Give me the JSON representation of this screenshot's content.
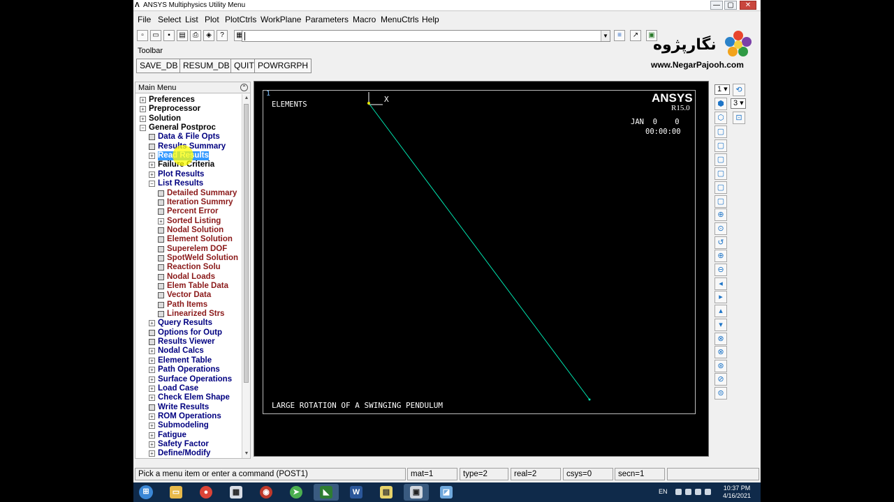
{
  "window": {
    "title": "ANSYS Multiphysics Utility Menu",
    "controls": {
      "minimize": "—",
      "maximize": "▢",
      "close": "✕"
    }
  },
  "menubar": [
    "File",
    "Select",
    "List",
    "Plot",
    "PlotCtrls",
    "WorkPlane",
    "Parameters",
    "Macro",
    "MenuCtrls",
    "Help"
  ],
  "command_input": {
    "value": ""
  },
  "toolbar": {
    "label": "Toolbar",
    "buttons": [
      "SAVE_DB",
      "RESUM_DB",
      "QUIT",
      "POWRGRPH"
    ]
  },
  "brand": {
    "name_fa": "نگارپژوه",
    "url": "www.NegarPajooh.com"
  },
  "main_menu": {
    "header": "Main Menu",
    "items": [
      {
        "label": "Preferences",
        "level": 0,
        "box": "+",
        "color": "black"
      },
      {
        "label": "Preprocessor",
        "level": 0,
        "box": "+",
        "color": "black"
      },
      {
        "label": "Solution",
        "level": 0,
        "box": "+",
        "color": "black"
      },
      {
        "label": "General Postproc",
        "level": 0,
        "box": "−",
        "color": "black"
      },
      {
        "label": "Data & File Opts",
        "level": 1,
        "box": "leaf",
        "color": "navy"
      },
      {
        "label": "Results Summary",
        "level": 1,
        "box": "leaf",
        "color": "navy"
      },
      {
        "label": "Read Results",
        "level": 1,
        "box": "+",
        "color": "navy",
        "selected": true
      },
      {
        "label": "Failure Criteria",
        "level": 1,
        "box": "+",
        "color": "black"
      },
      {
        "label": "Plot Results",
        "level": 1,
        "box": "+",
        "color": "navy"
      },
      {
        "label": "List Results",
        "level": 1,
        "box": "−",
        "color": "navy"
      },
      {
        "label": "Detailed Summary",
        "level": 2,
        "box": "leaf",
        "color": "brown"
      },
      {
        "label": "Iteration Summry",
        "level": 2,
        "box": "leaf",
        "color": "brown"
      },
      {
        "label": "Percent Error",
        "level": 2,
        "box": "leaf",
        "color": "brown"
      },
      {
        "label": "Sorted Listing",
        "level": 2,
        "box": "+",
        "color": "brown"
      },
      {
        "label": "Nodal Solution",
        "level": 2,
        "box": "leaf",
        "color": "brown"
      },
      {
        "label": "Element Solution",
        "level": 2,
        "box": "leaf",
        "color": "brown"
      },
      {
        "label": "Superelem DOF",
        "level": 2,
        "box": "leaf",
        "color": "brown"
      },
      {
        "label": "SpotWeld Solution",
        "level": 2,
        "box": "leaf",
        "color": "brown"
      },
      {
        "label": "Reaction Solu",
        "level": 2,
        "box": "leaf",
        "color": "brown"
      },
      {
        "label": "Nodal Loads",
        "level": 2,
        "box": "leaf",
        "color": "brown"
      },
      {
        "label": "Elem Table Data",
        "level": 2,
        "box": "leaf",
        "color": "brown"
      },
      {
        "label": "Vector Data",
        "level": 2,
        "box": "leaf",
        "color": "brown"
      },
      {
        "label": "Path Items",
        "level": 2,
        "box": "leaf",
        "color": "brown"
      },
      {
        "label": "Linearized Strs",
        "level": 2,
        "box": "leaf",
        "color": "brown"
      },
      {
        "label": "Query Results",
        "level": 1,
        "box": "+",
        "color": "navy"
      },
      {
        "label": "Options for Outp",
        "level": 1,
        "box": "leaf",
        "color": "navy"
      },
      {
        "label": "Results Viewer",
        "level": 1,
        "box": "leaf",
        "color": "navy"
      },
      {
        "label": "Nodal Calcs",
        "level": 1,
        "box": "+",
        "color": "navy"
      },
      {
        "label": "Element Table",
        "level": 1,
        "box": "+",
        "color": "navy"
      },
      {
        "label": "Path Operations",
        "level": 1,
        "box": "+",
        "color": "navy"
      },
      {
        "label": "Surface Operations",
        "level": 1,
        "box": "+",
        "color": "navy"
      },
      {
        "label": "Load Case",
        "level": 1,
        "box": "+",
        "color": "navy"
      },
      {
        "label": "Check Elem Shape",
        "level": 1,
        "box": "+",
        "color": "navy"
      },
      {
        "label": "Write Results",
        "level": 1,
        "box": "leaf",
        "color": "navy"
      },
      {
        "label": "ROM Operations",
        "level": 1,
        "box": "+",
        "color": "navy"
      },
      {
        "label": "Submodeling",
        "level": 1,
        "box": "+",
        "color": "navy"
      },
      {
        "label": "Fatigue",
        "level": 1,
        "box": "+",
        "color": "navy"
      },
      {
        "label": "Safety Factor",
        "level": 1,
        "box": "+",
        "color": "navy"
      },
      {
        "label": "Define/Modify",
        "level": 1,
        "box": "+",
        "color": "navy"
      }
    ]
  },
  "graphics": {
    "window_number": "1",
    "plot_type": "ELEMENTS",
    "brand": "ANSYS",
    "release": "R15.0",
    "date": "JAN  0    0",
    "time": "00:00:00",
    "axis_label": "X",
    "footer_title": "LARGE ROTATION OF A SWINGING PENDULUM",
    "element_color": "#00e5b0"
  },
  "right_toolbar": {
    "window_select": "1",
    "view_select": "3"
  },
  "status_bar": {
    "prompt": "Pick a menu item or enter a command (POST1)",
    "mat": "mat=1",
    "type": "type=2",
    "real": "real=2",
    "csys": "csys=0",
    "secn": "secn=1"
  },
  "taskbar": {
    "lang": "EN",
    "time": "10:37 PM",
    "date": "4/16/2021"
  }
}
